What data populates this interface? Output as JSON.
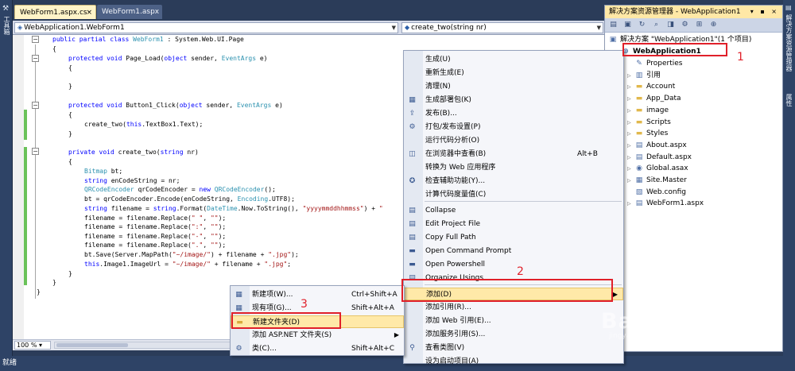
{
  "left_rail": {
    "label": "工具箱"
  },
  "tabs": [
    {
      "label": "WebForm1.aspx.cs",
      "close": "×"
    },
    {
      "label": "WebForm1.aspx"
    }
  ],
  "nav": {
    "left": "WebApplication1.WebForm1",
    "right": "create_two(string nr)"
  },
  "code": [
    [
      {
        "t": "public partial class ",
        "c": "kw"
      },
      {
        "t": "WebForm1",
        "c": "ty"
      },
      {
        "t": " : System.Web.UI.Page",
        "c": ""
      }
    ],
    [
      {
        "t": "{",
        "c": ""
      }
    ],
    [
      {
        "t": "protected void ",
        "c": "kw"
      },
      {
        "t": "Page_Load(",
        "c": ""
      },
      {
        "t": "object",
        "c": "kw"
      },
      {
        "t": " sender, ",
        "c": ""
      },
      {
        "t": "EventArgs",
        "c": "ty"
      },
      {
        "t": " e)",
        "c": ""
      }
    ],
    [
      {
        "t": "{",
        "c": ""
      }
    ],
    [
      {
        "t": "",
        "c": ""
      }
    ],
    [
      {
        "t": "}",
        "c": ""
      }
    ],
    [
      {
        "t": "",
        "c": ""
      }
    ],
    [
      {
        "t": "protected void ",
        "c": "kw"
      },
      {
        "t": "Button1_Click(",
        "c": ""
      },
      {
        "t": "object",
        "c": "kw"
      },
      {
        "t": " sender, ",
        "c": ""
      },
      {
        "t": "EventArgs",
        "c": "ty"
      },
      {
        "t": " e)",
        "c": ""
      }
    ],
    [
      {
        "t": "{",
        "c": ""
      }
    ],
    [
      {
        "t": "create_two(",
        "c": ""
      },
      {
        "t": "this",
        "c": "kw"
      },
      {
        "t": ".TextBox1.Text);",
        "c": ""
      }
    ],
    [
      {
        "t": "}",
        "c": ""
      }
    ],
    [
      {
        "t": "",
        "c": ""
      }
    ],
    [
      {
        "t": "private void ",
        "c": "kw"
      },
      {
        "t": "create_two(",
        "c": ""
      },
      {
        "t": "string",
        "c": "kw"
      },
      {
        "t": " nr)",
        "c": ""
      }
    ],
    [
      {
        "t": "{",
        "c": ""
      }
    ],
    [
      {
        "t": "Bitmap",
        "c": "ty"
      },
      {
        "t": " bt;",
        "c": ""
      }
    ],
    [
      {
        "t": "string",
        "c": "kw"
      },
      {
        "t": " enCodeString = nr;",
        "c": ""
      }
    ],
    [
      {
        "t": "QRCodeEncoder",
        "c": "ty"
      },
      {
        "t": " qrCodeEncoder = ",
        "c": ""
      },
      {
        "t": "new ",
        "c": "kw"
      },
      {
        "t": "QRCodeEncoder",
        "c": "ty"
      },
      {
        "t": "();",
        "c": ""
      }
    ],
    [
      {
        "t": "bt = qrCodeEncoder.Encode(enCodeString, ",
        "c": ""
      },
      {
        "t": "Encoding",
        "c": "ty"
      },
      {
        "t": ".UTF8);",
        "c": ""
      }
    ],
    [
      {
        "t": "string",
        "c": "kw"
      },
      {
        "t": " filename = ",
        "c": ""
      },
      {
        "t": "string",
        "c": "kw"
      },
      {
        "t": ".Format(",
        "c": ""
      },
      {
        "t": "DateTime",
        "c": "ty"
      },
      {
        "t": ".Now.ToString(), ",
        "c": ""
      },
      {
        "t": "\"yyyymmddhhmmss\"",
        "c": "st"
      },
      {
        "t": ") + ",
        "c": ""
      },
      {
        "t": "\"",
        "c": "st"
      }
    ],
    [
      {
        "t": "filename = filename.Replace(",
        "c": ""
      },
      {
        "t": "\" \"",
        "c": "st"
      },
      {
        "t": ", ",
        "c": ""
      },
      {
        "t": "\"\"",
        "c": "st"
      },
      {
        "t": ");",
        "c": ""
      }
    ],
    [
      {
        "t": "filename = filename.Replace(",
        "c": ""
      },
      {
        "t": "\":\"",
        "c": "st"
      },
      {
        "t": ", ",
        "c": ""
      },
      {
        "t": "\"\"",
        "c": "st"
      },
      {
        "t": ");",
        "c": ""
      }
    ],
    [
      {
        "t": "filename = filename.Replace(",
        "c": ""
      },
      {
        "t": "\"-\"",
        "c": "st"
      },
      {
        "t": ", ",
        "c": ""
      },
      {
        "t": "\"\"",
        "c": "st"
      },
      {
        "t": ");",
        "c": ""
      }
    ],
    [
      {
        "t": "filename = filename.Replace(",
        "c": ""
      },
      {
        "t": "\".\"",
        "c": "st"
      },
      {
        "t": ", ",
        "c": ""
      },
      {
        "t": "\"\"",
        "c": "st"
      },
      {
        "t": ");",
        "c": ""
      }
    ],
    [
      {
        "t": "bt.Save(Server.MapPath(",
        "c": ""
      },
      {
        "t": "\"~/image/\"",
        "c": "st"
      },
      {
        "t": ") + filename + ",
        "c": ""
      },
      {
        "t": "\".jpg\"",
        "c": "st"
      },
      {
        "t": ");",
        "c": ""
      }
    ],
    [
      {
        "t": "this",
        "c": "kw"
      },
      {
        "t": ".Image1.ImageUrl = ",
        "c": ""
      },
      {
        "t": "\"~/image/\"",
        "c": "st"
      },
      {
        "t": " + filename + ",
        "c": ""
      },
      {
        "t": "\".jpg\"",
        "c": "st"
      },
      {
        "t": ";",
        "c": ""
      }
    ],
    [
      {
        "t": "}",
        "c": ""
      }
    ],
    [
      {
        "t": "}",
        "c": ""
      }
    ],
    [
      {
        "t": "}",
        "c": ""
      }
    ]
  ],
  "editor_status": {
    "zoom": "100 %"
  },
  "bottom_status": "就绪",
  "solution": {
    "title": "解决方案资源管理器 - WebApplication1",
    "title_tools": "▾ ▪ ×",
    "root": "解决方案 \"WebApplication1\"(1 个项目)",
    "project": "WebApplication1",
    "items": [
      "Properties",
      "引用",
      "Account",
      "App_Data",
      "image",
      "Scripts",
      "Styles",
      "About.aspx",
      "Default.aspx",
      "Global.asax",
      "Site.Master",
      "Web.config",
      "WebForm1.aspx"
    ]
  },
  "right_rail": {
    "label1": "解决方案资源管理器",
    "label2": "属性"
  },
  "context_menu": [
    {
      "label": "生成(U)",
      "key": ""
    },
    {
      "label": "重新生成(E)",
      "key": ""
    },
    {
      "label": "清理(N)",
      "key": ""
    },
    {
      "label": "生成部署包(K)",
      "key": ""
    },
    {
      "label": "发布(B)...",
      "key": ""
    },
    {
      "label": "打包/发布设置(P)",
      "key": ""
    },
    {
      "label": "运行代码分析(O)",
      "key": ""
    },
    {
      "label": "在浏览器中查看(B)",
      "key": "Alt+B"
    },
    {
      "label": "转换为 Web 应用程序",
      "key": ""
    },
    {
      "label": "检查辅助功能(Y)...",
      "key": ""
    },
    {
      "label": "计算代码度量值(C)",
      "key": ""
    },
    {
      "label": "Collapse",
      "key": ""
    },
    {
      "label": "Edit Project File",
      "key": ""
    },
    {
      "label": "Copy Full Path",
      "key": ""
    },
    {
      "label": "Open Command Prompt",
      "key": ""
    },
    {
      "label": "Open Powershell",
      "key": ""
    },
    {
      "label": "Organize Usings",
      "key": ""
    },
    {
      "label": "添加(D)",
      "key": ""
    },
    {
      "label": "添加引用(R)...",
      "key": ""
    },
    {
      "label": "添加 Web 引用(E)...",
      "key": ""
    },
    {
      "label": "添加服务引用(S)...",
      "key": ""
    },
    {
      "label": "查看类图(V)",
      "key": ""
    },
    {
      "label": "设为启动项目(A)",
      "key": ""
    }
  ],
  "submenu": [
    {
      "label": "新建项(W)...",
      "key": "Ctrl+Shift+A"
    },
    {
      "label": "现有项(G)...",
      "key": "Shift+Alt+A"
    },
    {
      "label": "新建文件夹(D)",
      "key": ""
    },
    {
      "label": "添加 ASP.NET 文件夹(S)",
      "key": ""
    },
    {
      "label": "类(C)...",
      "key": "Shift+Alt+C"
    }
  ],
  "annotations": [
    "1",
    "2",
    "3"
  ],
  "watermark": {
    "main": "Bai 经验",
    "sub": "jingyan.baidu.com"
  },
  "colors": {
    "accent_highlight": "#ffe9a8",
    "annotation": "#e0202a",
    "chrome": "#2b3c59"
  }
}
